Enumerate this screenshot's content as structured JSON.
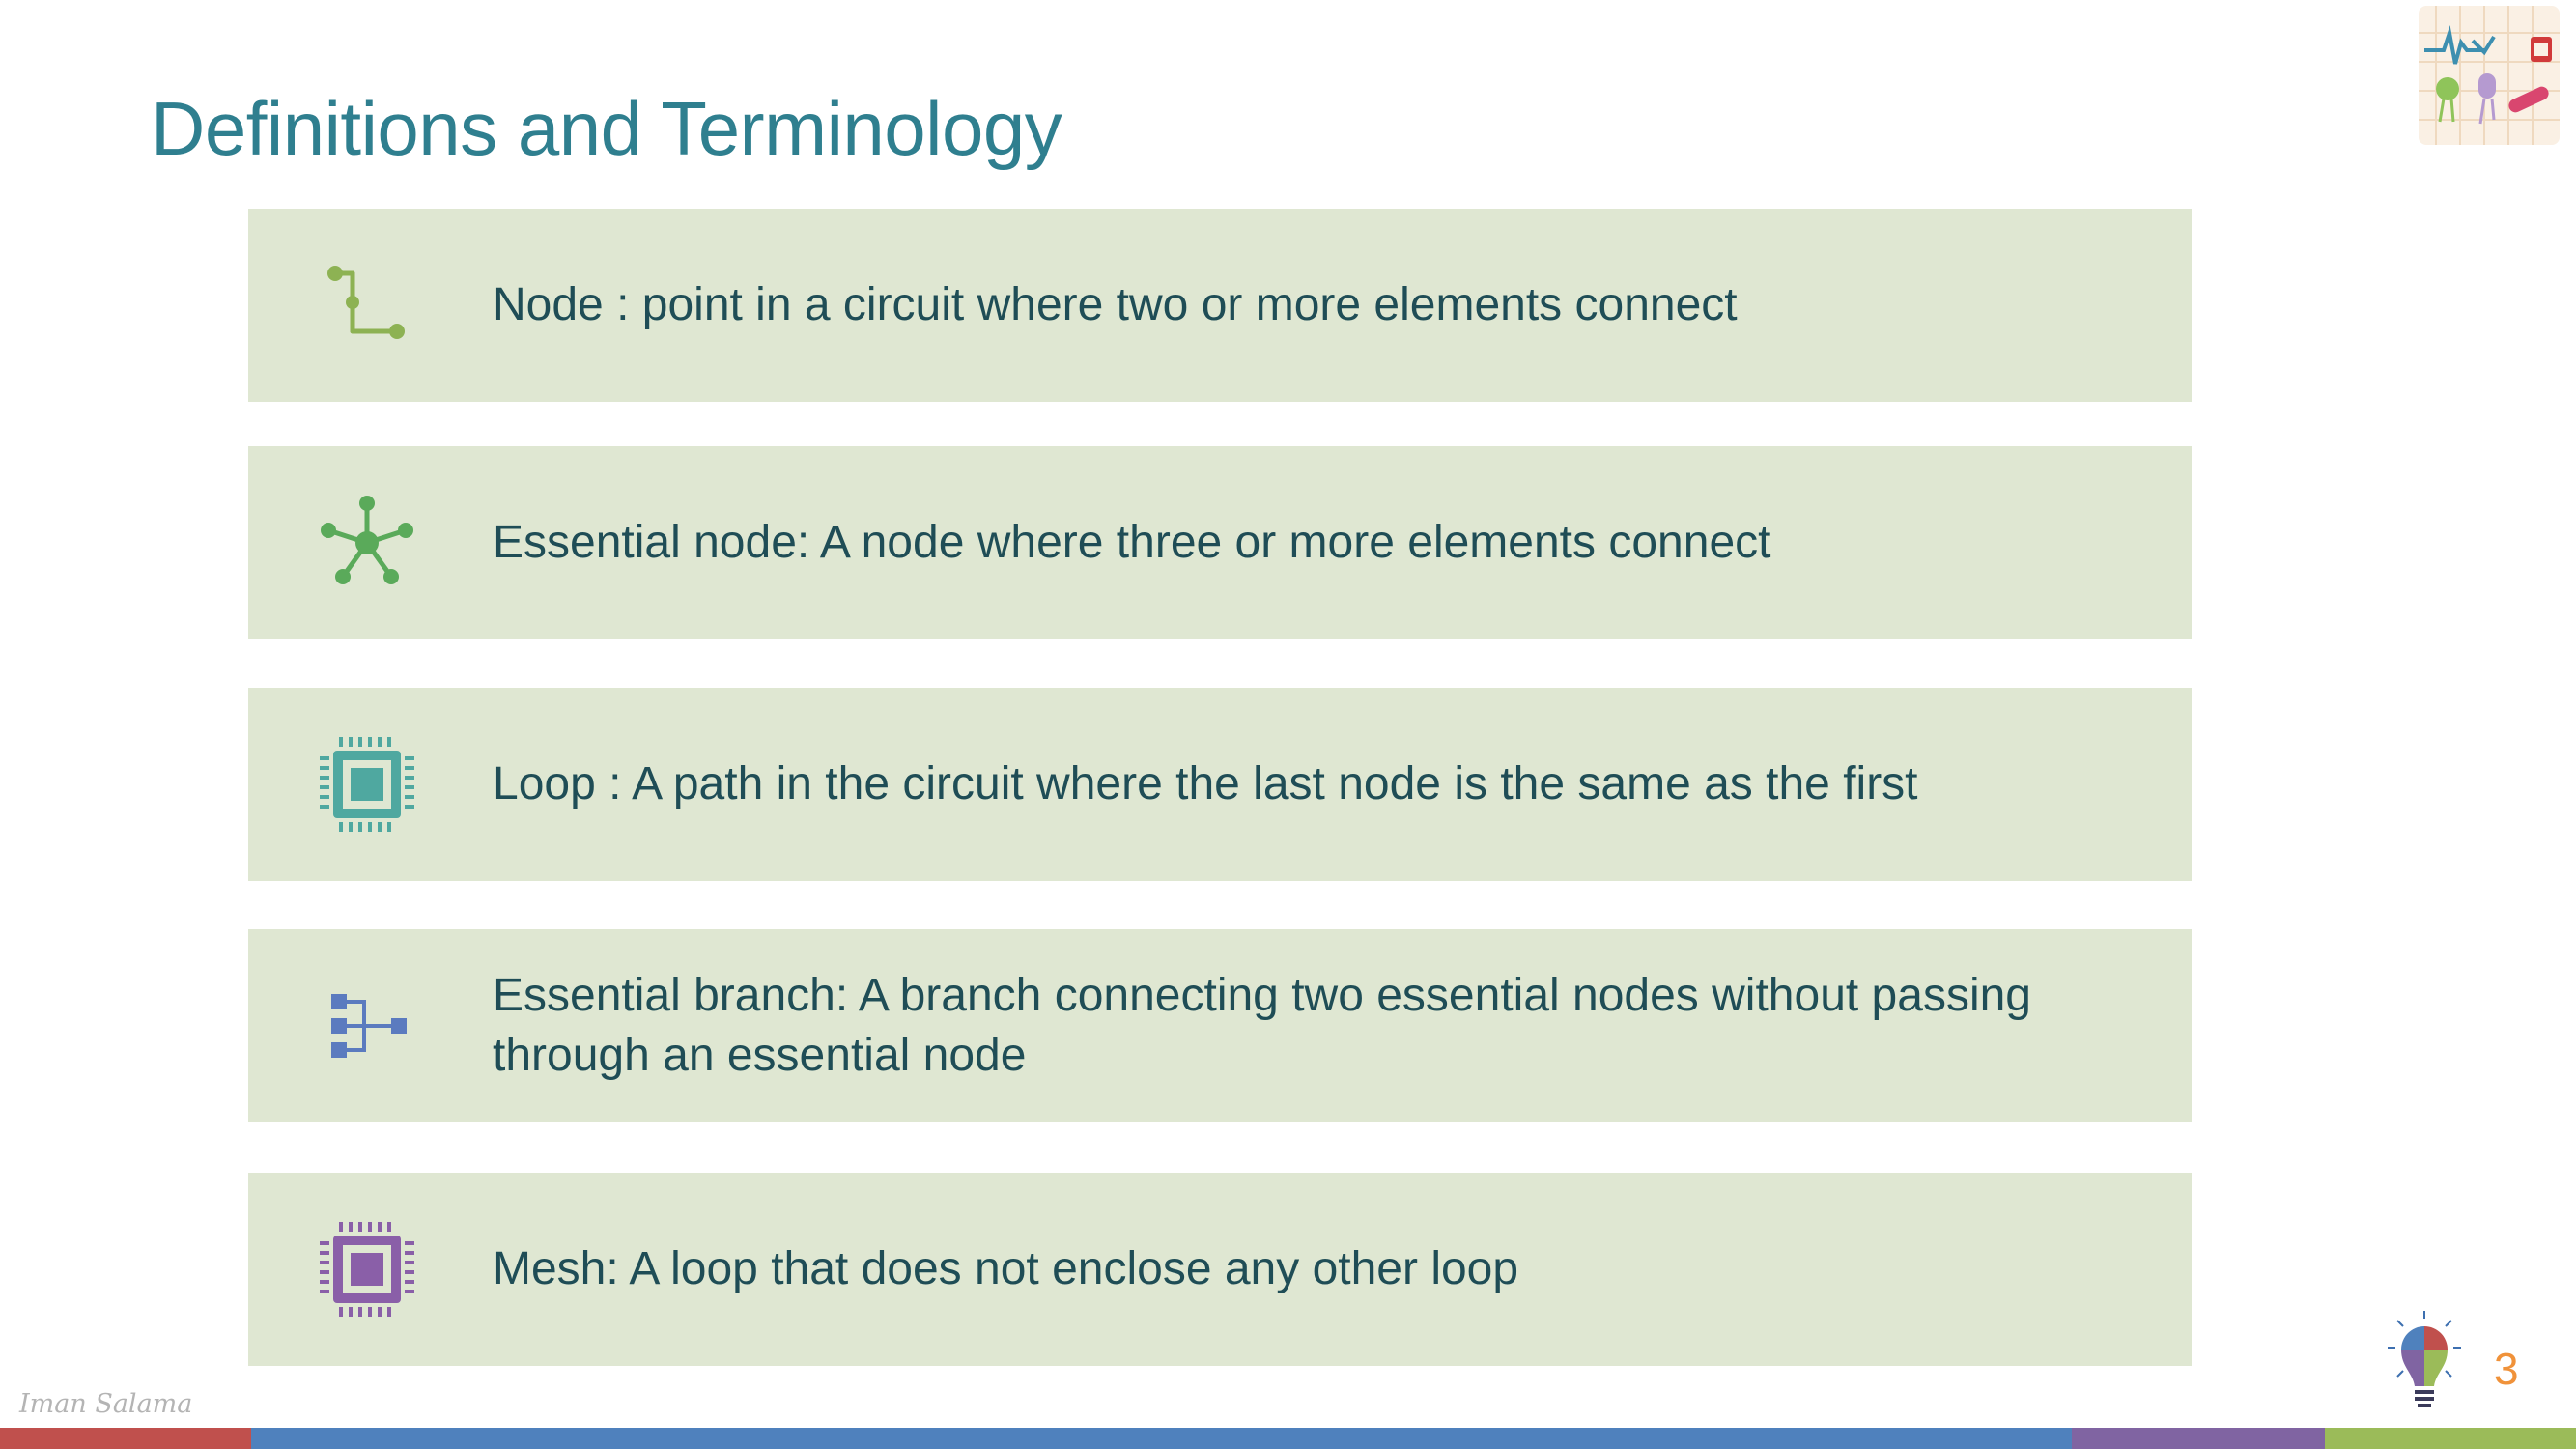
{
  "slide": {
    "title": "Definitions and Terminology",
    "author": "Iman Salama",
    "page_number": "3"
  },
  "definitions": [
    {
      "text": "Node : point in a circuit where two or more elements connect",
      "icon": "node-connector-icon",
      "icon_color": "#8db253"
    },
    {
      "text": "Essential node: A node where three or more elements connect",
      "icon": "hub-network-icon",
      "icon_color": "#5aaa5a"
    },
    {
      "text": "Loop : A  path in the circuit where the last node is the same as the first",
      "icon": "chip-icon",
      "icon_color": "#4fa8a0"
    },
    {
      "text": "Essential branch: A branch connecting two essential nodes without passing through an essential node",
      "icon": "branch-diagram-icon",
      "icon_color": "#5b7bbf"
    },
    {
      "text": "Mesh: A loop that does not enclose any other loop",
      "icon": "chip-icon",
      "icon_color": "#8a5fa8"
    }
  ],
  "colors": {
    "title": "#2f7f8f",
    "row_background": "#dfe7d2",
    "text": "#1f4d56",
    "page_number": "#f0923a",
    "bar_red": "#c0504d",
    "bar_blue": "#4f81bd",
    "bar_purple": "#8064a2",
    "bar_green": "#9bbb59"
  }
}
